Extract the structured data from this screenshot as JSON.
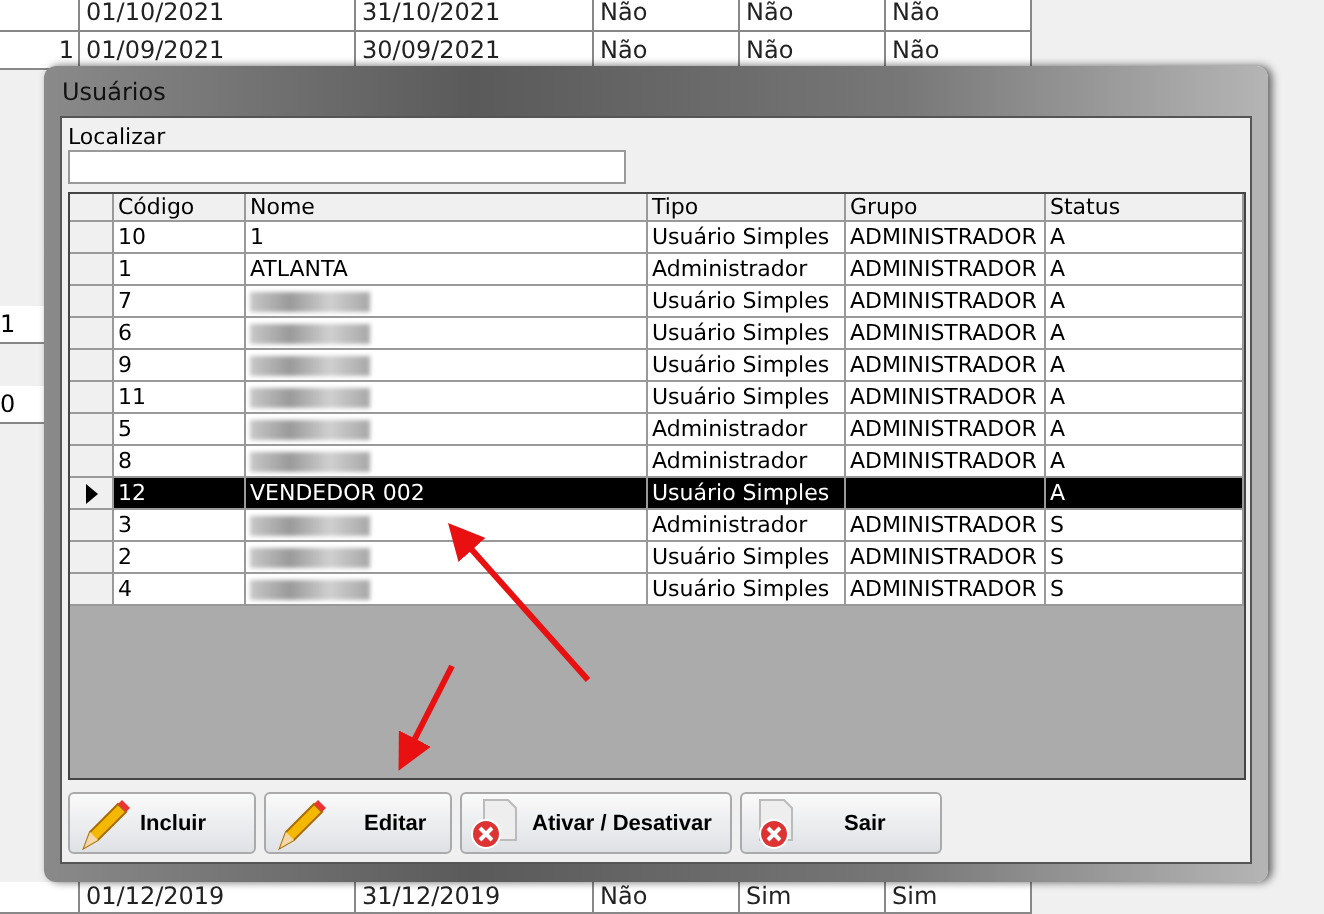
{
  "background_table": {
    "top_rows": [
      {
        "column_2": "01/10/2021",
        "column_3": "31/10/2021",
        "column_4": "Não",
        "column_5": "Não",
        "column_6": "Não"
      },
      {
        "column_1": "1",
        "column_2": "01/09/2021",
        "column_3": "30/09/2021",
        "column_4": "Não",
        "column_5": "Não",
        "column_6": "Não"
      }
    ],
    "side_cells": [
      "1",
      "0"
    ],
    "bottom_row": {
      "column_2": "01/12/2019",
      "column_3": "31/12/2019",
      "column_4": "Não",
      "column_5": "Sim",
      "column_6": "Sim"
    }
  },
  "window": {
    "title": "Usuários"
  },
  "search": {
    "label": "Localizar"
  },
  "table": {
    "columns": [
      "Código",
      "Nome",
      "Tipo",
      "Grupo",
      "Status"
    ],
    "rows": [
      {
        "codigo": "10",
        "nome": "1",
        "redacted": false,
        "tipo": "Usuário Simples",
        "grupo": "ADMINISTRADOR",
        "status": "A",
        "selected": false
      },
      {
        "codigo": "1",
        "nome": "ATLANTA",
        "redacted": false,
        "tipo": "Administrador",
        "grupo": "ADMINISTRADOR",
        "status": "A",
        "selected": false
      },
      {
        "codigo": "7",
        "redacted": true,
        "tipo": "Usuário Simples",
        "grupo": "ADMINISTRADOR",
        "status": "A",
        "selected": false
      },
      {
        "codigo": "6",
        "redacted": true,
        "tipo": "Usuário Simples",
        "grupo": "ADMINISTRADOR",
        "status": "A",
        "selected": false
      },
      {
        "codigo": "9",
        "redacted": true,
        "tipo": "Usuário Simples",
        "grupo": "ADMINISTRADOR",
        "status": "A",
        "selected": false
      },
      {
        "codigo": "11",
        "redacted": true,
        "tipo": "Usuário Simples",
        "grupo": "ADMINISTRADOR",
        "status": "A",
        "selected": false
      },
      {
        "codigo": "5",
        "redacted": true,
        "tipo": "Administrador",
        "grupo": "ADMINISTRADOR",
        "status": "A",
        "selected": false
      },
      {
        "codigo": "8",
        "redacted": true,
        "tipo": "Administrador",
        "grupo": "ADMINISTRADOR",
        "status": "A",
        "selected": false
      },
      {
        "codigo": "12",
        "nome": "VENDEDOR 002",
        "redacted": false,
        "tipo": "Usuário Simples",
        "status": "A",
        "selected": true
      },
      {
        "codigo": "3",
        "redacted": true,
        "tipo": "Administrador",
        "grupo": "ADMINISTRADOR",
        "status": "S",
        "selected": false
      },
      {
        "codigo": "2",
        "redacted": true,
        "tipo": "Usuário Simples",
        "grupo": "ADMINISTRADOR",
        "status": "S",
        "selected": false
      },
      {
        "codigo": "4",
        "redacted": true,
        "tipo": "Usuário Simples",
        "grupo": "ADMINISTRADOR",
        "status": "S",
        "selected": false
      }
    ]
  },
  "buttons": [
    {
      "label": "Incluir",
      "kind": "pencil"
    },
    {
      "label": "Editar",
      "kind": "pencil"
    },
    {
      "label": "Ativar / Desativar",
      "kind": "cancel-doc"
    },
    {
      "label": "Sair",
      "kind": "cancel"
    }
  ]
}
